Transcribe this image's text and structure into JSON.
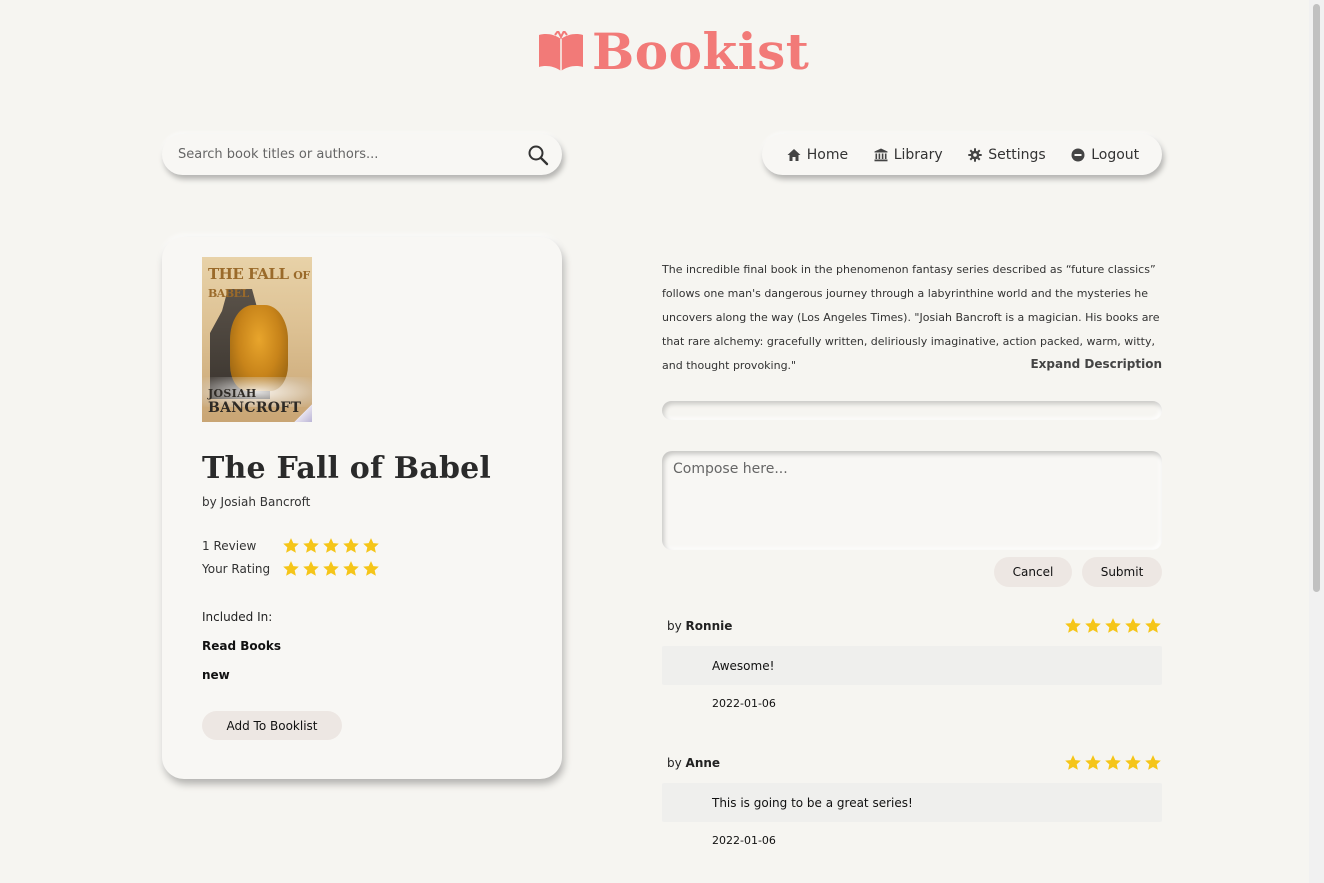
{
  "brand": {
    "name": "Bookist",
    "color": "#f27a78",
    "icon": "open-book-icon"
  },
  "search": {
    "placeholder": "Search book titles or authors...",
    "icon": "search-icon"
  },
  "nav": {
    "items": [
      {
        "label": "Home",
        "icon": "home-icon"
      },
      {
        "label": "Library",
        "icon": "library-icon"
      },
      {
        "label": "Settings",
        "icon": "gear-icon"
      },
      {
        "label": "Logout",
        "icon": "logout-icon"
      }
    ]
  },
  "book": {
    "title": "The Fall of Babel",
    "author_line": "by Josiah Bancroft",
    "cover": {
      "title_main": "THE FALL",
      "title_small": "OF BABEL",
      "author_first": "JOSIAH ",
      "author_last": "BANCROFT"
    },
    "reviews_label": "1 Review",
    "reviews_stars": 5,
    "your_rating_label": "Your Rating",
    "your_rating_stars": 5,
    "star_color": "#f5c518",
    "included_label": "Included In:",
    "shelves": [
      "Read Books",
      "new"
    ],
    "add_button": "Add To Booklist",
    "description": "The incredible final book in the phenomenon fantasy series described as “future classics” follows one man's dangerous journey through a labyrinthine world and the mysteries he uncovers along the way (Los Angeles Times). \"Josiah Bancroft is a magician. His books are that rare alchemy: gracefully written, deliriously imaginative, action packed, warm, witty, and thought provoking.\"",
    "expand_label": "Expand Description",
    "reading_progress": 0
  },
  "compose": {
    "placeholder": "Compose here...",
    "cancel": "Cancel",
    "submit": "Submit"
  },
  "reviews": [
    {
      "by": "by ",
      "user": "Ronnie",
      "stars": 5,
      "text": "Awesome!",
      "date": "2022-01-06"
    },
    {
      "by": "by ",
      "user": "Anne",
      "stars": 5,
      "text": "This is going to be a great series!",
      "date": "2022-01-06"
    }
  ]
}
